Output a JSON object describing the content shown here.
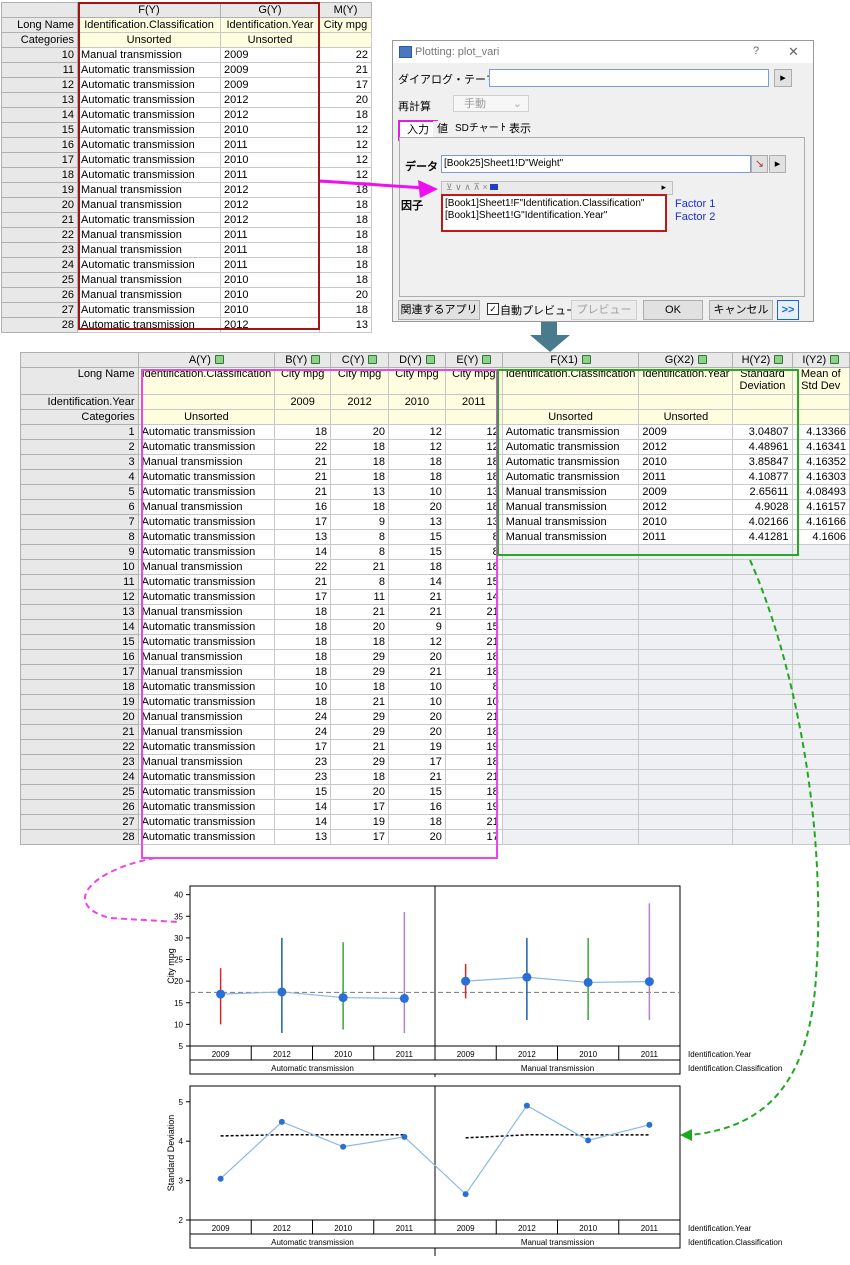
{
  "top_sheet": {
    "col_headers": [
      "F(Y)",
      "G(Y)",
      "M(Y)"
    ],
    "long_name_label": "Long Name",
    "long_names": [
      "Identification.Classification",
      "Identification.Year",
      "City mpg"
    ],
    "categories_label": "Categories",
    "categories": [
      "Unsorted",
      "Unsorted",
      ""
    ],
    "rows": [
      [
        "10",
        "Manual transmission",
        "2009",
        "22"
      ],
      [
        "11",
        "Automatic transmission",
        "2009",
        "21"
      ],
      [
        "12",
        "Automatic transmission",
        "2009",
        "17"
      ],
      [
        "13",
        "Automatic transmission",
        "2012",
        "20"
      ],
      [
        "14",
        "Automatic transmission",
        "2012",
        "18"
      ],
      [
        "15",
        "Automatic transmission",
        "2010",
        "12"
      ],
      [
        "16",
        "Automatic transmission",
        "2011",
        "12"
      ],
      [
        "17",
        "Automatic transmission",
        "2010",
        "12"
      ],
      [
        "18",
        "Automatic transmission",
        "2011",
        "12"
      ],
      [
        "19",
        "Manual transmission",
        "2012",
        "18"
      ],
      [
        "20",
        "Manual transmission",
        "2012",
        "18"
      ],
      [
        "21",
        "Automatic transmission",
        "2012",
        "18"
      ],
      [
        "22",
        "Manual transmission",
        "2011",
        "18"
      ],
      [
        "23",
        "Manual transmission",
        "2011",
        "18"
      ],
      [
        "24",
        "Automatic transmission",
        "2011",
        "18"
      ],
      [
        "25",
        "Manual transmission",
        "2010",
        "18"
      ],
      [
        "26",
        "Manual transmission",
        "2010",
        "20"
      ],
      [
        "27",
        "Automatic transmission",
        "2010",
        "18"
      ],
      [
        "28",
        "Automatic transmission",
        "2012",
        "13"
      ]
    ]
  },
  "dialog": {
    "title": "Plotting: plot_vari",
    "help": "?",
    "close": "✕",
    "theme_label": "ダイアログ・テーマ(H)",
    "recalc_label": "再計算",
    "recalc_value": "手動",
    "tabs": [
      "入力",
      "値",
      "SDチャート",
      "表示"
    ],
    "data_label": "データ",
    "data_value": "[Book25]Sheet1!D\"Weight\"",
    "factor_label": "因子",
    "factor_values": [
      "[Book1]Sheet1!F\"Identification.Classification\"",
      "[Book1]Sheet1!G\"Identification.Year\""
    ],
    "factor_annotations": [
      "Factor 1",
      "Factor 2"
    ],
    "buttons": {
      "related_apps": "関連するアプリ",
      "auto_preview": "自動プレビュー",
      "preview": "プレビュー",
      "ok": "OK",
      "cancel": "キャンセル",
      "more": ">>"
    }
  },
  "big_sheet": {
    "col_headers": [
      "A(Y)",
      "B(Y)",
      "C(Y)",
      "D(Y)",
      "E(Y)",
      "F(X1)",
      "G(X2)",
      "H(Y2)",
      "I(Y2)"
    ],
    "long_name_label": "Long Name",
    "long_names": [
      "Identification.Classification",
      "City mpg",
      "City mpg",
      "City mpg",
      "City mpg",
      "Identification.Classification",
      "Identification.Year",
      "Standard Deviation",
      "Mean of Std Dev"
    ],
    "year_label": "Identification.Year",
    "years": [
      "",
      "2009",
      "2012",
      "2010",
      "2011",
      "",
      "",
      "",
      ""
    ],
    "categories_label": "Categories",
    "categories": [
      "Unsorted",
      "",
      "",
      "",
      "",
      "Unsorted",
      "Unsorted",
      "",
      ""
    ],
    "rows": [
      [
        "1",
        "Automatic transmission",
        "18",
        "20",
        "12",
        "12"
      ],
      [
        "2",
        "Automatic transmission",
        "22",
        "18",
        "12",
        "12"
      ],
      [
        "3",
        "Manual transmission",
        "21",
        "18",
        "18",
        "18"
      ],
      [
        "4",
        "Automatic transmission",
        "21",
        "18",
        "18",
        "18"
      ],
      [
        "5",
        "Automatic transmission",
        "21",
        "13",
        "10",
        "13"
      ],
      [
        "6",
        "Manual transmission",
        "16",
        "18",
        "20",
        "18"
      ],
      [
        "7",
        "Automatic transmission",
        "17",
        "9",
        "13",
        "13"
      ],
      [
        "8",
        "Automatic transmission",
        "13",
        "8",
        "15",
        "8"
      ],
      [
        "9",
        "Automatic transmission",
        "14",
        "8",
        "15",
        "8"
      ],
      [
        "10",
        "Manual transmission",
        "22",
        "21",
        "18",
        "18"
      ],
      [
        "11",
        "Automatic transmission",
        "21",
        "8",
        "14",
        "15"
      ],
      [
        "12",
        "Automatic transmission",
        "17",
        "11",
        "21",
        "14"
      ],
      [
        "13",
        "Manual transmission",
        "18",
        "21",
        "21",
        "21"
      ],
      [
        "14",
        "Automatic transmission",
        "18",
        "20",
        "9",
        "15"
      ],
      [
        "15",
        "Automatic transmission",
        "18",
        "18",
        "12",
        "21"
      ],
      [
        "16",
        "Manual transmission",
        "18",
        "29",
        "20",
        "18"
      ],
      [
        "17",
        "Manual transmission",
        "18",
        "29",
        "21",
        "18"
      ],
      [
        "18",
        "Automatic transmission",
        "10",
        "18",
        "10",
        "8"
      ],
      [
        "19",
        "Automatic transmission",
        "18",
        "21",
        "10",
        "10"
      ],
      [
        "20",
        "Manual transmission",
        "24",
        "29",
        "20",
        "21"
      ],
      [
        "21",
        "Manual transmission",
        "24",
        "29",
        "20",
        "18"
      ],
      [
        "22",
        "Automatic transmission",
        "17",
        "21",
        "19",
        "19"
      ],
      [
        "23",
        "Manual transmission",
        "23",
        "29",
        "17",
        "18"
      ],
      [
        "24",
        "Automatic transmission",
        "23",
        "18",
        "21",
        "21"
      ],
      [
        "25",
        "Automatic transmission",
        "15",
        "20",
        "15",
        "18"
      ],
      [
        "26",
        "Automatic transmission",
        "14",
        "17",
        "16",
        "19"
      ],
      [
        "27",
        "Automatic transmission",
        "14",
        "19",
        "18",
        "21"
      ],
      [
        "28",
        "Automatic transmission",
        "13",
        "17",
        "20",
        "17"
      ]
    ],
    "result_rows": [
      [
        "Automatic transmission",
        "2009",
        "3.04807",
        "4.13366"
      ],
      [
        "Automatic transmission",
        "2012",
        "4.48961",
        "4.16341"
      ],
      [
        "Automatic transmission",
        "2010",
        "3.85847",
        "4.16352"
      ],
      [
        "Automatic transmission",
        "2011",
        "4.10877",
        "4.16303"
      ],
      [
        "Manual transmission",
        "2009",
        "2.65611",
        "4.08493"
      ],
      [
        "Manual transmission",
        "2012",
        "4.9028",
        "4.16157"
      ],
      [
        "Manual transmission",
        "2010",
        "4.02166",
        "4.16166"
      ],
      [
        "Manual transmission",
        "2011",
        "4.41281",
        "4.1606"
      ]
    ]
  },
  "chart_data": [
    {
      "type": "scatter",
      "ylabel": "City mpg",
      "ylim": [
        5,
        42
      ],
      "yticks": [
        5,
        10,
        15,
        20,
        25,
        30,
        35,
        40
      ],
      "groups": [
        "Automatic transmission",
        "Manual transmission"
      ],
      "categories": [
        "2009",
        "2012",
        "2010",
        "2011"
      ],
      "x_axis_labels": [
        "Identification.Year",
        "Identification.Classification"
      ],
      "means": [
        17,
        17.5,
        16.2,
        16,
        20,
        20.9,
        19.7,
        19.9
      ],
      "range_low": [
        10,
        8,
        8.8,
        8,
        16,
        11,
        11,
        11
      ],
      "range_high": [
        23,
        30,
        29,
        36,
        24,
        30,
        30,
        38
      ],
      "grand_mean": 17.4,
      "colors": [
        "#d62828",
        "#1f5fa8",
        "#3aa53a",
        "#b083c9"
      ]
    },
    {
      "type": "line",
      "ylabel": "Standard Deviation",
      "ylim": [
        2,
        5.4
      ],
      "yticks": [
        2,
        3,
        4,
        5
      ],
      "groups": [
        "Automatic transmission",
        "Manual transmission"
      ],
      "categories": [
        "2009",
        "2012",
        "2010",
        "2011"
      ],
      "x_axis_labels": [
        "Identification.Year",
        "Identification.Classification"
      ],
      "values": [
        3.04807,
        4.48961,
        3.85847,
        4.10877,
        2.65611,
        4.9028,
        4.02166,
        4.41281
      ],
      "mean_of_sd": [
        4.13366,
        4.16341,
        4.16352,
        4.16303,
        4.08493,
        4.16157,
        4.16166,
        4.1606
      ]
    }
  ]
}
